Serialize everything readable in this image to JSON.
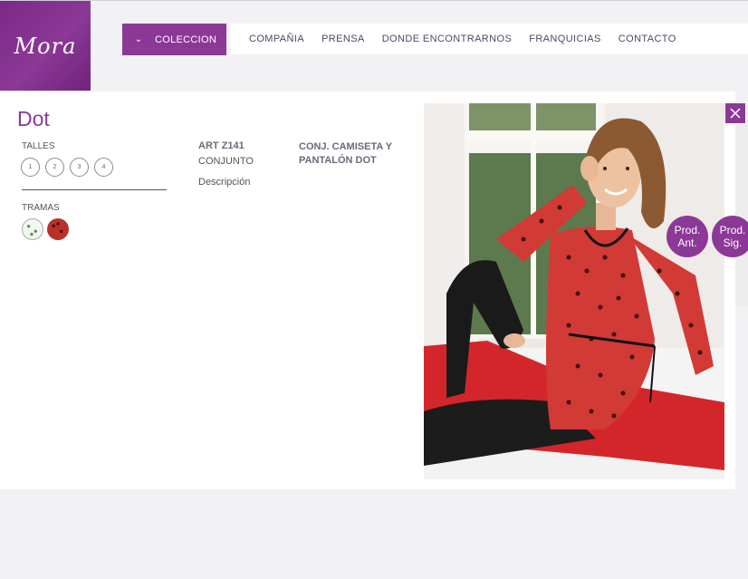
{
  "brand": {
    "logo_text": "Mora",
    "accent_color": "#8b3897"
  },
  "nav": {
    "coleccion_label": "COLECCION",
    "items": [
      {
        "label": "COMPAÑIA"
      },
      {
        "label": "PRENSA"
      },
      {
        "label": "DONDE ENCONTRARNOS"
      },
      {
        "label": "FRANQUICIAS"
      },
      {
        "label": "CONTACTO"
      }
    ]
  },
  "product": {
    "title": "Dot",
    "talles_label": "TALLES",
    "sizes": [
      "1",
      "2",
      "3",
      "4"
    ],
    "tramas_label": "TRAMAS",
    "swatches": [
      "white-green-dots",
      "red-dark-dots"
    ],
    "art_code": "ART Z141",
    "art_type": "CONJUNTO",
    "description_link": "Descripción",
    "name": "CONJ. CAMISETA Y PANTALÓN DOT"
  },
  "controls": {
    "prev_label": "Prod. Ant.",
    "next_label": "Prod. Sig.",
    "close_icon": "close-icon"
  }
}
